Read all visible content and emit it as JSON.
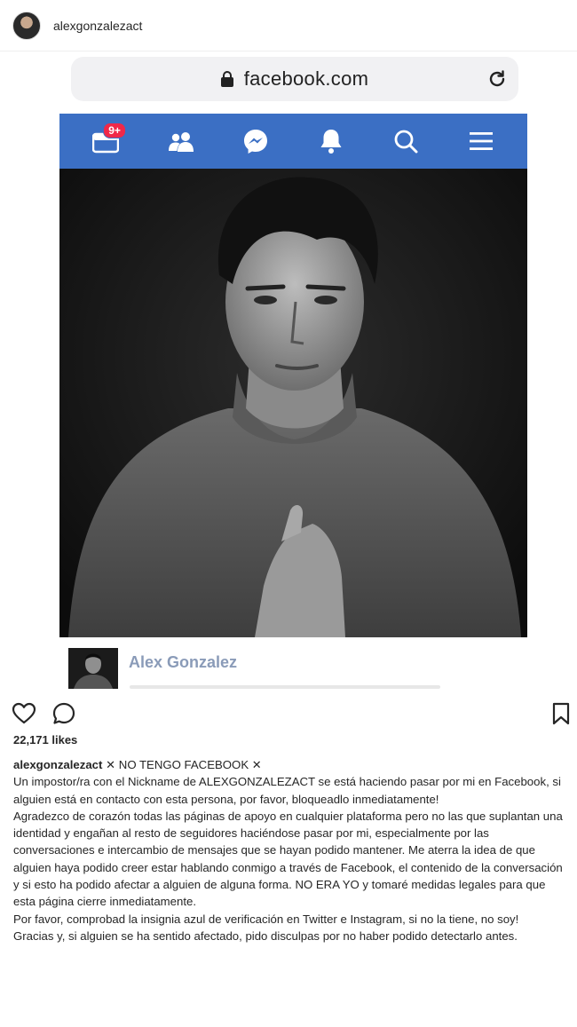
{
  "header": {
    "username": "alexgonzalezact"
  },
  "browser": {
    "url": "facebook.com"
  },
  "facebook_nav": {
    "badge": "9+",
    "icons": [
      "news-feed-icon",
      "friends-icon",
      "messenger-icon",
      "notifications-icon",
      "search-icon",
      "menu-icon"
    ]
  },
  "post_author": {
    "name": "Alex Gonzalez"
  },
  "stats": {
    "likes": "22,171 likes"
  },
  "caption": {
    "username": "alexgonzalezact",
    "headline": " ✕ NO TENGO FACEBOOK ✕",
    "paragraphs": [
      "Un impostor/ra con el Nickname de ALEXGONZALEZACT se está haciendo pasar por mi en Facebook, si alguien está en contacto con esta persona, por favor, bloqueadlo inmediatamente!",
      "Agradezco de corazón todas las páginas de apoyo en cualquier plataforma pero no las que suplantan una identidad y engañan al resto de seguidores haciéndose pasar por mi, especialmente por las conversaciones e intercambio de mensajes que se hayan podido mantener. Me aterra la idea de que alguien haya podido creer estar hablando conmigo a través de Facebook, el contenido de la conversación y si esto ha podido afectar a alguien de alguna forma. NO ERA YO y tomaré medidas legales para que esta página cierre inmediatamente.",
      "Por favor, comprobad la insignia azul de verificación en Twitter e Instagram, si no la tiene, no soy!",
      "Gracias y, si alguien se ha sentido afectado, pido disculpas por no haber podido detectarlo antes."
    ]
  }
}
